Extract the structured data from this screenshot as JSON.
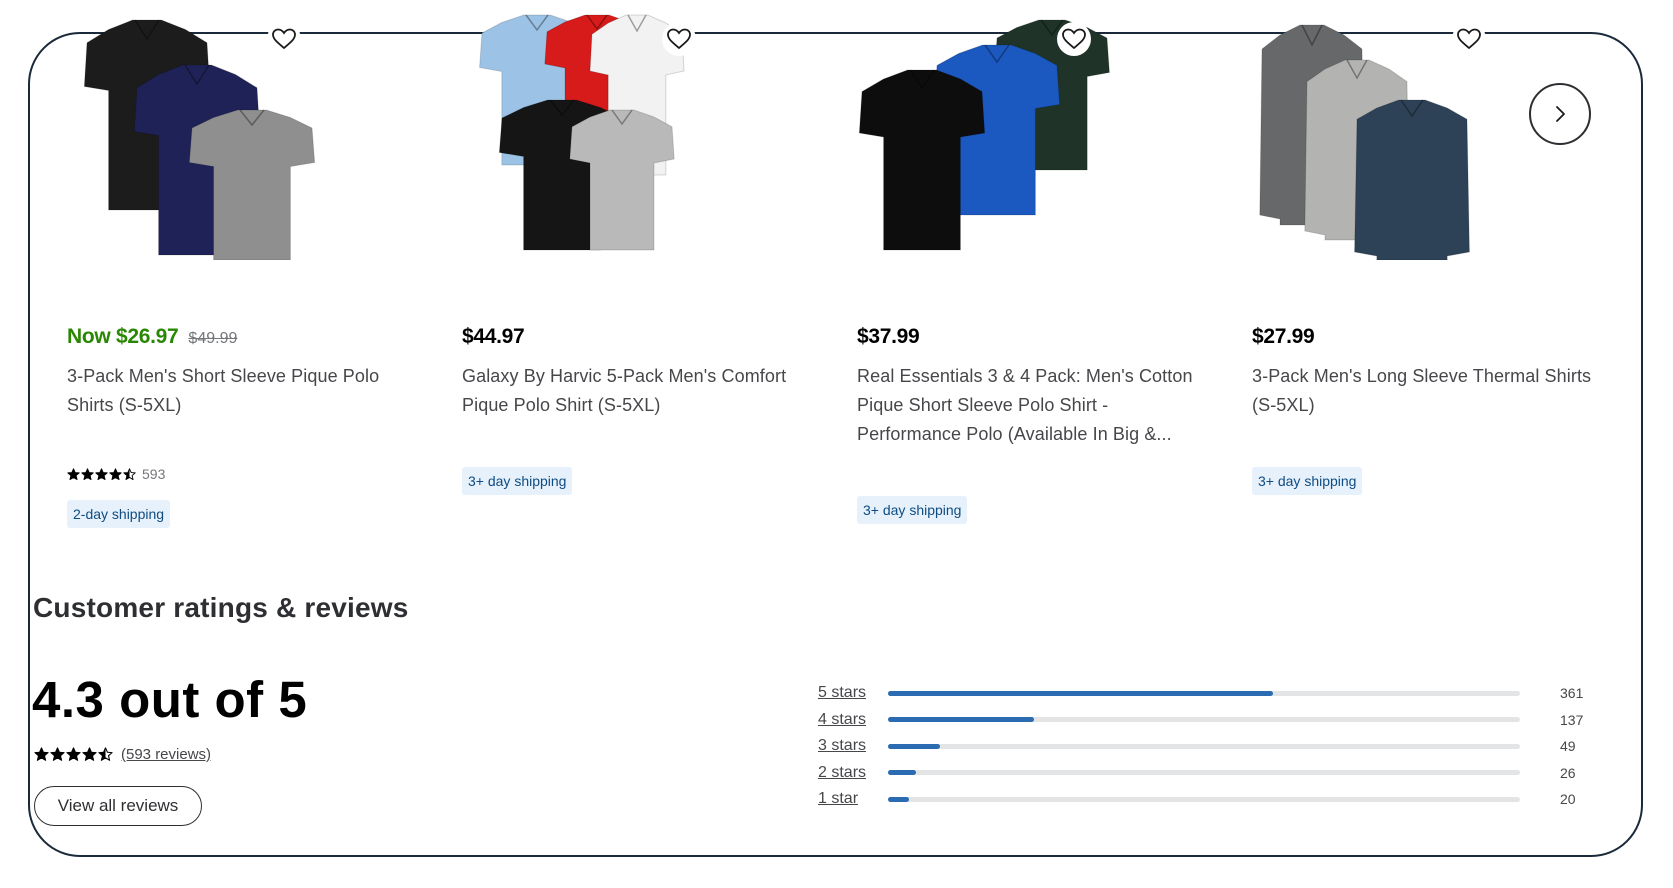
{
  "carousel": {
    "next_label": "Next slide",
    "products": [
      {
        "image_desc": "Three men's short sleeve polo shirts: black, navy, gray",
        "shirt_colors": [
          "#1c1c1c",
          "#1f2257",
          "#8f8f8f"
        ],
        "price_prefix": "Now",
        "price": "$26.97",
        "was_price": "$49.99",
        "on_sale": true,
        "title": "3-Pack Men's Short Sleeve Pique Polo Shirts (S-5XL)",
        "rating": 4.5,
        "rating_count": "593",
        "shipping": "2-day shipping"
      },
      {
        "image_desc": "Five men's polo shirts: light blue, red, white, black, gray",
        "shirt_colors": [
          "#9cc3e6",
          "#d71a1a",
          "#f2f2f2",
          "#151515",
          "#b9b9b9"
        ],
        "price_prefix": "",
        "price": "$44.97",
        "was_price": "",
        "on_sale": false,
        "title": "Galaxy By Harvic 5-Pack Men's Comfort Pique Polo Shirt (S-5XL)",
        "rating": null,
        "rating_count": "",
        "shipping": "3+ day shipping"
      },
      {
        "image_desc": "Three polo shirts: dark green, royal blue, black",
        "shirt_colors": [
          "#1f3328",
          "#1b58bf",
          "#0d0d0d"
        ],
        "price_prefix": "",
        "price": "$37.99",
        "was_price": "",
        "on_sale": false,
        "title": "Real Essentials 3 & 4 Pack: Men's Cotton Pique Short Sleeve Polo Shirt - Performance Polo (Available In Big &...",
        "rating": null,
        "rating_count": "",
        "shipping": "3+ day shipping"
      },
      {
        "image_desc": "Three long sleeve thermal shirts: charcoal, light gray, navy",
        "shirt_colors": [
          "#66686a",
          "#b3b3b1",
          "#2d4256"
        ],
        "price_prefix": "",
        "price": "$27.99",
        "was_price": "",
        "on_sale": false,
        "title": "3-Pack Men's Long Sleeve Thermal Shirts (S-5XL)",
        "rating": null,
        "rating_count": "",
        "shipping": "3+ day shipping"
      }
    ]
  },
  "reviews": {
    "section_title": "Customer ratings & reviews",
    "average_text": "4.3 out of 5",
    "average": 4.3,
    "stars_shown": 4.5,
    "reviews_link": "(593 reviews)",
    "total": 593,
    "view_all_label": "View all reviews",
    "distribution": [
      {
        "label": "5 stars",
        "count": 361
      },
      {
        "label": "4 stars",
        "count": 137
      },
      {
        "label": "3 stars",
        "count": 49
      },
      {
        "label": "2 stars",
        "count": 26
      },
      {
        "label": "1 star",
        "count": 20
      }
    ]
  },
  "colors": {
    "sale_green": "#2a8703",
    "bar_blue": "#2a6bb1",
    "badge_bg": "#e6f1fc",
    "badge_text": "#0f4c81",
    "frame_border": "#1b2a3a"
  }
}
